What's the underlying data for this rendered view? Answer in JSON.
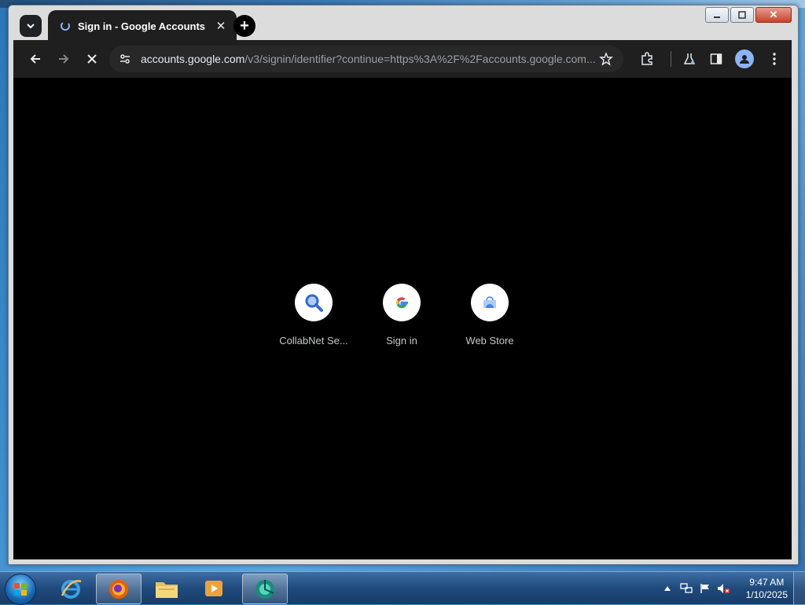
{
  "browser": {
    "tab": {
      "title": "Sign in - Google Accounts",
      "close_glyph": "✕"
    },
    "new_tab_glyph": "+",
    "window_close_glyph": "✕",
    "address": {
      "host": "accounts.google.com",
      "path": "/v3/signin/identifier?continue=https%3A%2F%2Faccounts.google.com..."
    },
    "icons": [
      "chevron-down-icon",
      "back-arrow-icon",
      "forward-arrow-icon",
      "stop-icon",
      "site-info-icon",
      "star-icon",
      "extensions-icon",
      "labs-flask-icon",
      "side-panel-icon",
      "profile-icon",
      "more-menu-icon"
    ]
  },
  "shortcuts": [
    {
      "label": "CollabNet Se...",
      "icon": "search-magnifier-icon"
    },
    {
      "label": "Sign in",
      "icon": "google-g-icon"
    },
    {
      "label": "Web Store",
      "icon": "web-store-icon"
    }
  ],
  "taskbar": {
    "apps": [
      "internet-explorer-icon",
      "firefox-icon",
      "file-explorer-icon",
      "media-player-icon",
      "browser-app-icon"
    ],
    "clock": {
      "time": "9:47 AM",
      "date": "1/10/2025"
    }
  },
  "colors": {
    "content_bg": "#000000",
    "toolbar_bg": "#1f1f1f",
    "accent_blue": "#8ab4f8"
  }
}
